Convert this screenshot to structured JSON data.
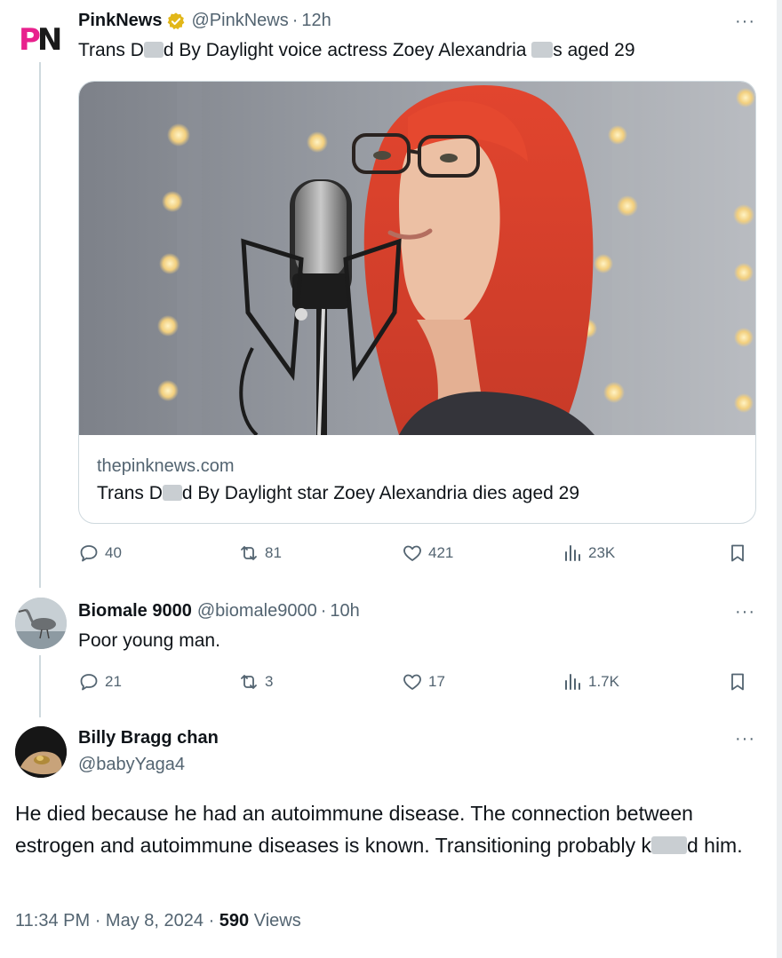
{
  "tweet1": {
    "avatar_text_p": "P",
    "avatar_text_n": "N",
    "name": "PinkNews",
    "handle": "@PinkNews",
    "separator": "·",
    "time": "12h",
    "text_part1": "Trans D",
    "text_part2": "d By Daylight voice actress Zoey Alexandria ",
    "text_part3": "s aged 29",
    "card": {
      "domain": "thepinknews.com",
      "title_part1": "Trans D",
      "title_part2": "d By Daylight star Zoey Alexandria dies aged 29"
    },
    "actions": {
      "replies": "40",
      "reposts": "81",
      "likes": "421",
      "views": "23K"
    }
  },
  "tweet2": {
    "name": "Biomale 9000",
    "handle": "@biomale9000",
    "separator": "·",
    "time": "10h",
    "text": "Poor young man.",
    "actions": {
      "replies": "21",
      "reposts": "3",
      "likes": "17",
      "views": "1.7K"
    }
  },
  "tweet3": {
    "name": "Billy Bragg chan",
    "handle": "@babyYaga4",
    "body_part1": "He died because he had an autoimmune disease. The connection between estrogen and autoimmune diseases is known. Transitioning probably k",
    "body_part2": "d him.",
    "meta": {
      "time": "11:34 PM",
      "separator": "·",
      "date": "May 8, 2024",
      "views_count": "590",
      "views_label": "Views"
    }
  },
  "more_label": "···",
  "colors": {
    "accent_pink": "#e8218d",
    "verified_gold": "#e2b719",
    "text_primary": "#0f1419",
    "text_secondary": "#536471",
    "border": "#cfd9de"
  },
  "icons": [
    "verified-badge-icon",
    "reply-icon",
    "repost-icon",
    "like-icon",
    "views-icon",
    "bookmark-icon",
    "more-icon"
  ]
}
